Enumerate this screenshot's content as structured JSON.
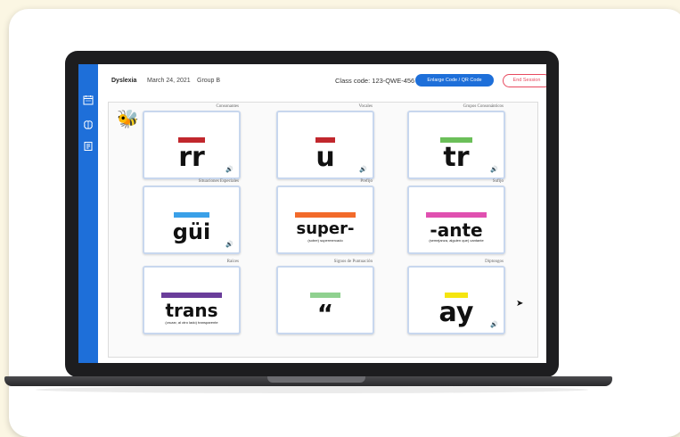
{
  "header": {
    "app_name": "Dyslexia",
    "date": "March 24, 2021",
    "group": "Group B",
    "class_code": "Class code: 123-QWE-456",
    "enlarge_button": "Enlarge Code / QR Code",
    "end_button": "End Session"
  },
  "sidebar": {
    "icons": [
      "calendar-icon",
      "brain-icon",
      "notes-icon"
    ]
  },
  "tiles": [
    {
      "category": "Consonantes",
      "text": "rr",
      "subtext": "",
      "bar_color": "#c1272d"
    },
    {
      "category": "Vocales",
      "text": "u",
      "subtext": "",
      "bar_color": "#c1272d"
    },
    {
      "category": "Grupos Consonánticos",
      "text": "tr",
      "subtext": "",
      "bar_color": "#6bbf59"
    },
    {
      "category": "Situaciones Especiales",
      "text": "güi",
      "subtext": "",
      "bar_color": "#3aa0e8"
    },
    {
      "category": "Prefijo",
      "text": "super-",
      "subtext": "(sobre) supermercado",
      "bar_color": "#f26a2a"
    },
    {
      "category": "Sufijo",
      "text": "-ante",
      "subtext": "(semejanza, alguien que) cantante",
      "bar_color": "#e050b0"
    },
    {
      "category": "Raíces",
      "text": "trans",
      "subtext": "(cruzar, al otro lado) transparente",
      "bar_color": "#6a3d9a"
    },
    {
      "category": "Signos de Puntuación",
      "text": "“",
      "subtext": "",
      "bar_color": "#8fd18f"
    },
    {
      "category": "Diptongos",
      "text": "ay",
      "subtext": "",
      "bar_color": "#f5e50f"
    }
  ],
  "colors": {
    "accent": "#1e6fd9",
    "end_button": "#e84a5f",
    "background": "#fbf6e3"
  }
}
